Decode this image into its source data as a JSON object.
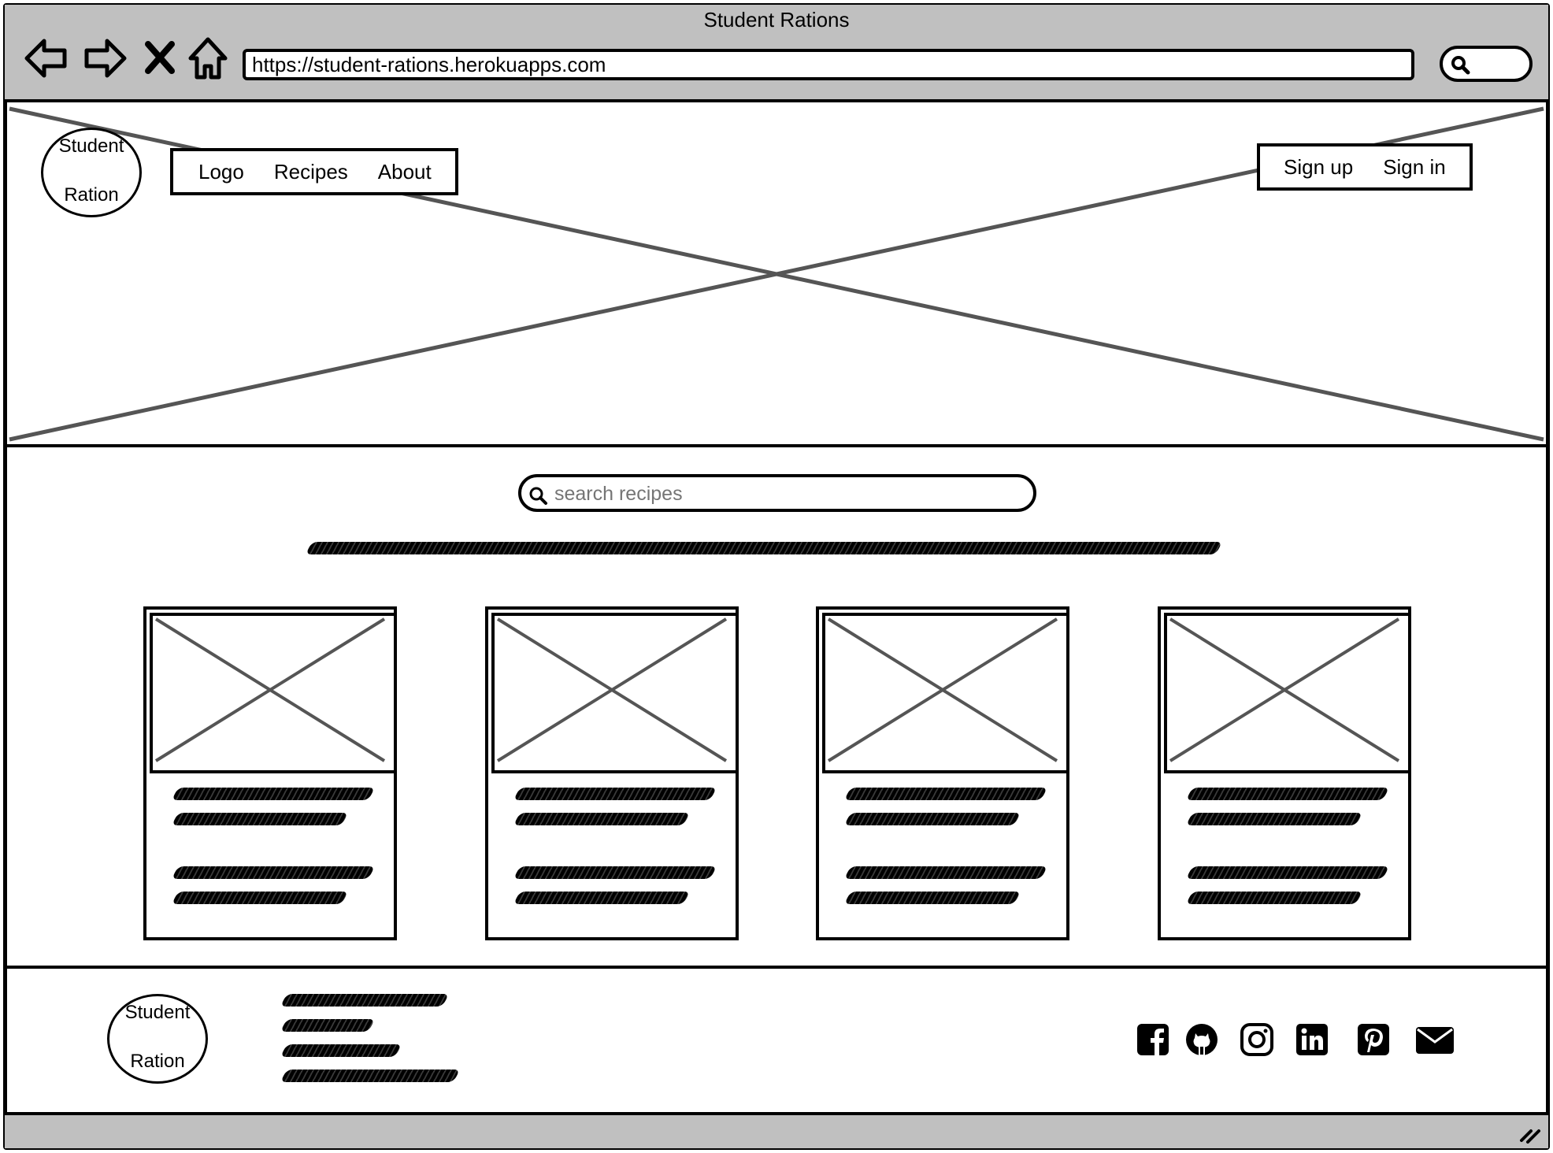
{
  "browser": {
    "title": "Student Rations",
    "url": "https://student-rations.herokuapps.com"
  },
  "header": {
    "logo": {
      "line1": "Student",
      "line2": "Ration"
    },
    "nav": [
      {
        "label": "Logo"
      },
      {
        "label": "Recipes"
      },
      {
        "label": "About"
      }
    ],
    "auth": [
      {
        "label": "Sign up"
      },
      {
        "label": "Sign in"
      }
    ]
  },
  "search": {
    "placeholder": "search recipes",
    "value": ""
  },
  "footer": {
    "logo": {
      "line1": "Student",
      "line2": "Ration"
    },
    "social_icons": [
      "facebook-icon",
      "github-icon",
      "instagram-icon",
      "linkedin-icon",
      "pinterest-icon",
      "mail-icon"
    ]
  }
}
